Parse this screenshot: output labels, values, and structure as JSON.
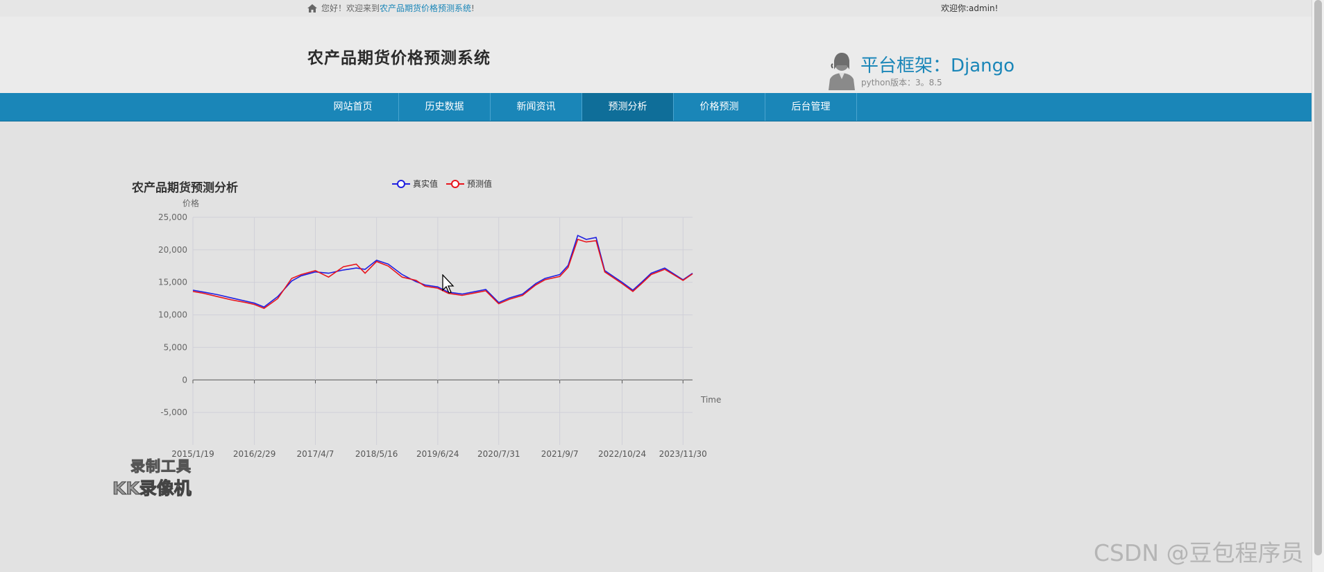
{
  "topbar": {
    "greeting_prefix": "您好！欢迎来到",
    "greeting_site": "农产品期货价格预测系统",
    "greeting_suffix": "!",
    "user": "欢迎你:admin!"
  },
  "header": {
    "site_title": "农产品期货价格预测系统",
    "framework_title": "平台框架：Django",
    "python_version": "python版本：3。8.5"
  },
  "nav": {
    "items": [
      {
        "label": "网站首页",
        "active": false
      },
      {
        "label": "历史数据",
        "active": false
      },
      {
        "label": "新闻资讯",
        "active": false
      },
      {
        "label": "预测分析",
        "active": true
      },
      {
        "label": "价格预测",
        "active": false
      },
      {
        "label": "后台管理",
        "active": false
      }
    ]
  },
  "colors": {
    "accent": "#1a86b8",
    "actual_series": "#1f1fe0",
    "predicted_series": "#e8141c"
  },
  "chart_data": {
    "type": "line",
    "title": "农产品期货预测分析",
    "ylabel": "价格",
    "xlabel": "Time",
    "ylim": [
      -10000,
      25000
    ],
    "yticks": [
      -5000,
      0,
      5000,
      10000,
      15000,
      20000,
      25000
    ],
    "ytick_labels": [
      "-5,000",
      "0",
      "5,000",
      "10,000",
      "15,000",
      "20,000",
      "25,000"
    ],
    "xtick_labels": [
      "2015/1/19",
      "2016/2/29",
      "2017/4/7",
      "2018/5/16",
      "2019/6/24",
      "2020/7/31",
      "2021/9/7",
      "2022/10/24",
      "2023/11/30"
    ],
    "grid": true,
    "legend": "top-center",
    "series": [
      {
        "name": "真实值",
        "x": [
          "2015/1/19",
          "2015/4/1",
          "2015/7/1",
          "2015/10/1",
          "2016/1/4",
          "2016/2/29",
          "2016/5/3",
          "2016/8/1",
          "2016/11/1",
          "2017/1/3",
          "2017/4/7",
          "2017/7/3",
          "2017/10/9",
          "2018/1/2",
          "2018/3/1",
          "2018/5/16",
          "2018/8/1",
          "2018/11/1",
          "2019/2/1",
          "2019/4/1",
          "2019/6/24",
          "2019/9/2",
          "2019/12/2",
          "2020/3/2",
          "2020/5/6",
          "2020/7/31",
          "2020/10/9",
          "2021/1/4",
          "2021/4/1",
          "2021/6/1",
          "2021/9/7",
          "2021/11/1",
          "2022/1/4",
          "2022/3/1",
          "2022/5/5",
          "2022/7/1",
          "2022/10/24",
          "2023/1/3",
          "2023/3/1",
          "2023/5/4",
          "2023/8/1",
          "2023/11/30",
          "2024/2/1"
        ],
        "values": [
          13800,
          13500,
          13100,
          12600,
          12100,
          11800,
          11200,
          12800,
          15200,
          16000,
          16600,
          16400,
          16900,
          17200,
          17000,
          18400,
          17800,
          16200,
          15100,
          14600,
          14300,
          13500,
          13200,
          13600,
          13900,
          11900,
          12600,
          13200,
          14800,
          15600,
          16200,
          17600,
          22200,
          21600,
          21900,
          16800,
          15000,
          13800,
          15000,
          16400,
          17200,
          15400,
          16400
        ]
      },
      {
        "name": "预测值",
        "x": [
          "2015/1/19",
          "2015/4/1",
          "2015/7/1",
          "2015/10/1",
          "2016/1/4",
          "2016/2/29",
          "2016/5/3",
          "2016/8/1",
          "2016/11/1",
          "2017/1/3",
          "2017/4/7",
          "2017/7/3",
          "2017/10/9",
          "2018/1/2",
          "2018/3/1",
          "2018/5/16",
          "2018/8/1",
          "2018/11/1",
          "2019/2/1",
          "2019/4/1",
          "2019/6/24",
          "2019/9/2",
          "2019/12/2",
          "2020/3/2",
          "2020/5/6",
          "2020/7/31",
          "2020/10/9",
          "2021/1/4",
          "2021/4/1",
          "2021/6/1",
          "2021/9/7",
          "2021/11/1",
          "2022/1/4",
          "2022/3/1",
          "2022/5/5",
          "2022/7/1",
          "2022/10/24",
          "2023/1/3",
          "2023/3/1",
          "2023/5/4",
          "2023/8/1",
          "2023/11/30",
          "2024/2/1"
        ],
        "values": [
          13600,
          13300,
          12800,
          12300,
          11900,
          11600,
          11000,
          12500,
          15600,
          16200,
          16800,
          15800,
          17400,
          17800,
          16400,
          18200,
          17500,
          15800,
          15300,
          14400,
          14100,
          13300,
          13000,
          13400,
          13700,
          11700,
          12400,
          13000,
          14600,
          15400,
          15900,
          17300,
          21600,
          21200,
          21400,
          16600,
          14800,
          13600,
          14800,
          16200,
          17000,
          15300,
          16300
        ]
      }
    ]
  },
  "watermarks": {
    "recorder_line1": "录制工具",
    "recorder_line2": "KK录像机",
    "csdn": "CSDN @豆包程序员"
  }
}
